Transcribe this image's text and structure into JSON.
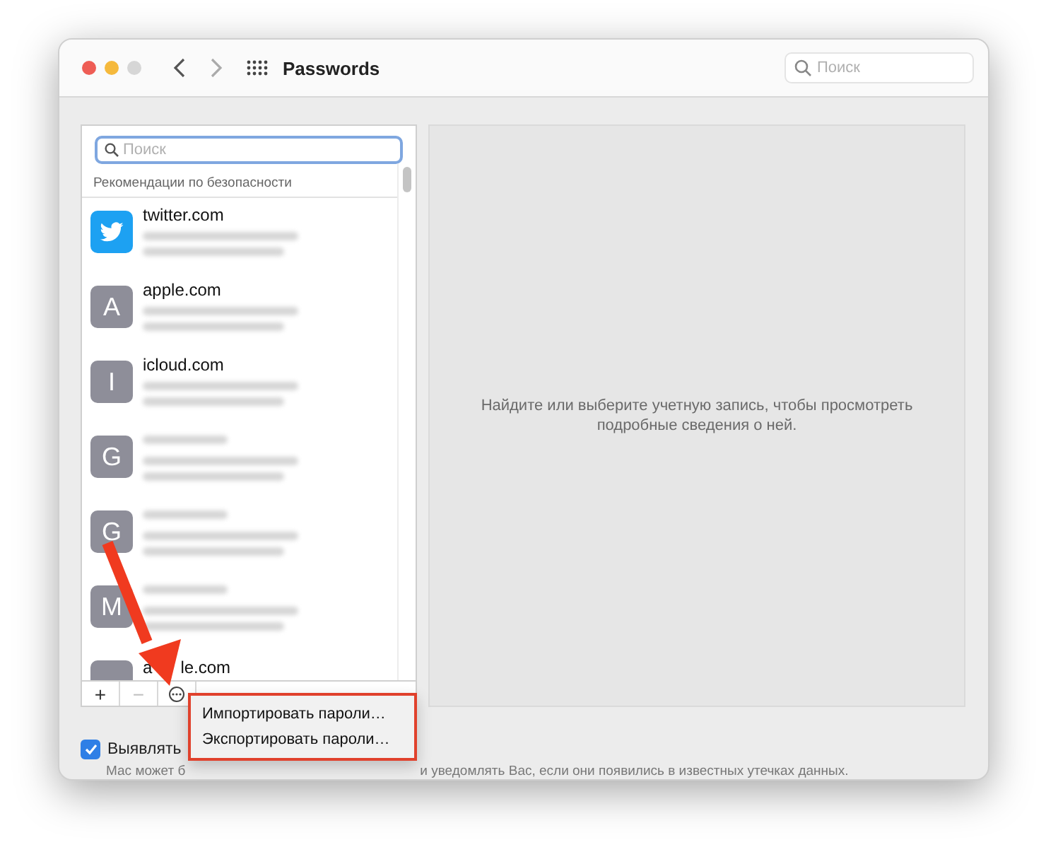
{
  "window": {
    "title": "Passwords",
    "search": {
      "placeholder": "Поиск"
    }
  },
  "sidebar": {
    "search": {
      "placeholder": "Поиск"
    },
    "section": "Рекомендации по безопасности",
    "accounts": [
      {
        "kind": "twitter",
        "name": "twitter.com"
      },
      {
        "kind": "letter",
        "letter": "A",
        "name": "apple.com"
      },
      {
        "kind": "letter",
        "letter": "I",
        "name": "icloud.com"
      },
      {
        "kind": "letter",
        "letter": "G"
      },
      {
        "kind": "letter",
        "letter": "G"
      },
      {
        "kind": "letter",
        "letter": "M"
      },
      {
        "kind": "blank",
        "name_parts": [
          "a",
          "le.com"
        ]
      }
    ],
    "toolbar": [
      {
        "label": "+",
        "disabled": false
      },
      {
        "label": "−",
        "disabled": true
      }
    ]
  },
  "menu": {
    "items": [
      "Импортировать пароли…",
      "Экспортировать пароли…"
    ]
  },
  "detail": {
    "message": "Найдите или выберите учетную запись, чтобы просмотреть подробные сведения о ней."
  },
  "leaks": {
    "label": "Выявлять",
    "checked": true,
    "note": [
      "Мас может б",
      "и уведомлять Вас, если они появились в известных утечках данных."
    ]
  }
}
